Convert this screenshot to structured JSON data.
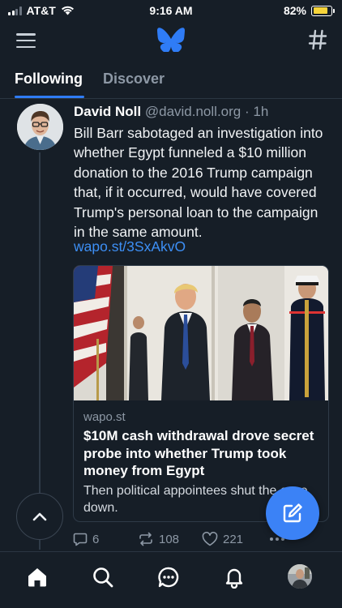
{
  "status_bar": {
    "carrier": "AT&T",
    "time": "9:16 AM",
    "battery_percent": "82%",
    "battery_level": 0.82,
    "battery_color": "#f7d43a",
    "icons": [
      "signal-bars-icon",
      "wifi-icon",
      "battery-icon"
    ]
  },
  "topnav": {
    "icons": [
      "menu-icon",
      "butterfly-logo-icon",
      "hashtag-icon"
    ],
    "logo_color": "#2f7cf6"
  },
  "tabs": [
    {
      "label": "Following",
      "active": true
    },
    {
      "label": "Discover",
      "active": false
    }
  ],
  "post": {
    "author_name": "David Noll",
    "author_handle": "@david.noll.org",
    "separator": " · ",
    "timestamp": "1h",
    "text": "Bill Barr sabotaged an investigation into whether Egypt funneled a $10 million donation to the 2016 Trump campaign that, if it occurred, would have covered Trump's personal loan to the campaign in the same amount.",
    "link_text": "wapo.st/3SxAkvO",
    "embed": {
      "domain": "wapo.st",
      "title": "$10M cash withdrawal drove secret probe into whether Trump took money from Egypt",
      "description": "Then political appointees shut the case down."
    },
    "actions": {
      "reply_count": "6",
      "repost_count": "108",
      "like_count": "221"
    }
  },
  "bottom_nav": {
    "items": [
      "home-icon",
      "search-icon",
      "chat-icon",
      "notifications-bell-icon",
      "profile-avatar"
    ]
  },
  "colors": {
    "background": "#161e27",
    "accent": "#3b82f6",
    "link": "#3d8ff5",
    "muted": "#8d98a5"
  }
}
